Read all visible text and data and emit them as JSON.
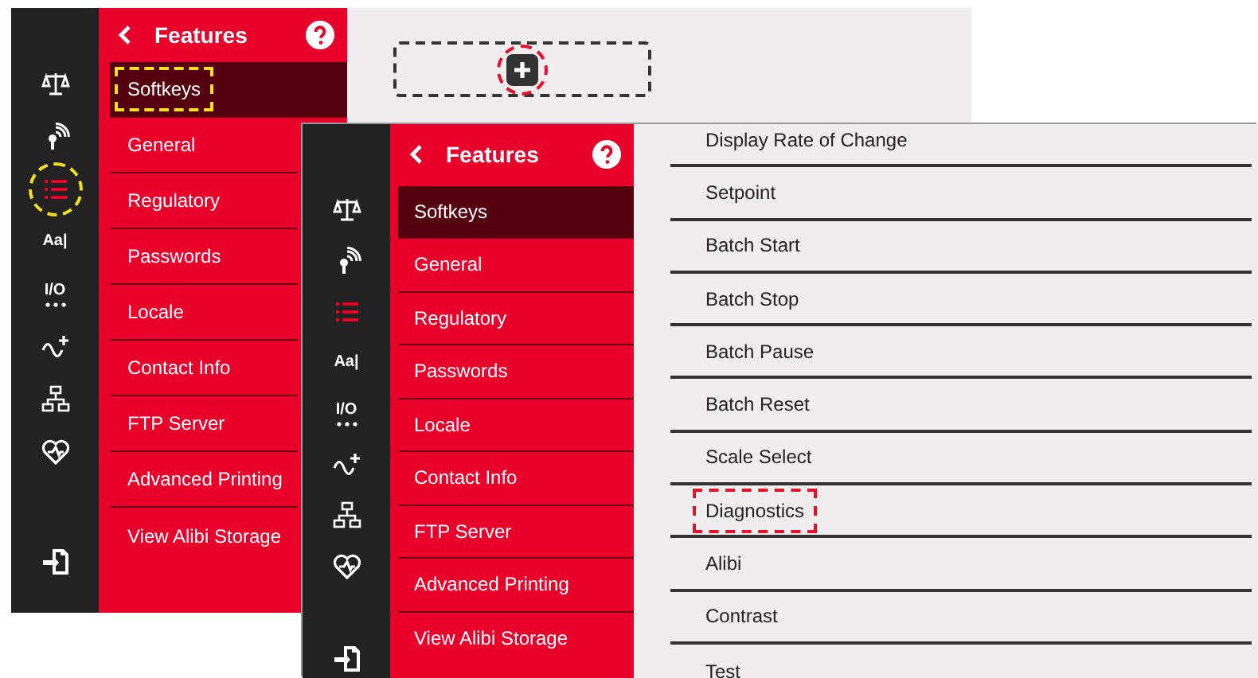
{
  "screens": [
    {
      "rail": [
        {
          "kind": "scale",
          "selected": false
        },
        {
          "kind": "signal",
          "selected": false
        },
        {
          "kind": "list",
          "selected": true,
          "highlighted": true,
          "color": "#f5e11a"
        },
        {
          "kind": "text",
          "label": "Aa|",
          "selected": false
        },
        {
          "kind": "io",
          "label": "I/O",
          "selected": false
        },
        {
          "kind": "wave",
          "selected": false
        },
        {
          "kind": "network",
          "selected": false
        },
        {
          "kind": "heart",
          "selected": false
        },
        {
          "kind": "exit",
          "selected": false
        }
      ],
      "panel": {
        "title": "Features",
        "items": [
          {
            "label": "Softkeys",
            "selected": true,
            "highlighted": true,
            "color": "#f5e11a"
          },
          {
            "label": "General",
            "selected": false
          },
          {
            "label": "Regulatory",
            "selected": false
          },
          {
            "label": "Passwords",
            "selected": false
          },
          {
            "label": "Locale",
            "selected": false
          },
          {
            "label": "Contact Info",
            "selected": false
          },
          {
            "label": "FTP Server",
            "selected": false
          },
          {
            "label": "Advanced Printing",
            "selected": false
          },
          {
            "label": "View Alibi Storage",
            "selected": false
          }
        ]
      },
      "content": {
        "kind": "add-slot",
        "highlighted": true,
        "color": "#e8102a"
      }
    },
    {
      "rail": [
        {
          "kind": "scale",
          "selected": false
        },
        {
          "kind": "signal",
          "selected": false
        },
        {
          "kind": "list",
          "selected": true
        },
        {
          "kind": "text",
          "label": "Aa|",
          "selected": false
        },
        {
          "kind": "io",
          "label": "I/O",
          "selected": false
        },
        {
          "kind": "wave",
          "selected": false
        },
        {
          "kind": "network",
          "selected": false
        },
        {
          "kind": "heart",
          "selected": false
        },
        {
          "kind": "exit",
          "selected": false
        }
      ],
      "panel": {
        "title": "Features",
        "items": [
          {
            "label": "Softkeys",
            "selected": true
          },
          {
            "label": "General",
            "selected": false
          },
          {
            "label": "Regulatory",
            "selected": false
          },
          {
            "label": "Passwords",
            "selected": false
          },
          {
            "label": "Locale",
            "selected": false
          },
          {
            "label": "Contact Info",
            "selected": false
          },
          {
            "label": "FTP Server",
            "selected": false
          },
          {
            "label": "Advanced Printing",
            "selected": false
          },
          {
            "label": "View Alibi Storage",
            "selected": false
          }
        ]
      },
      "content": {
        "kind": "list",
        "items": [
          {
            "label": "Display Rate of Change"
          },
          {
            "label": "Setpoint"
          },
          {
            "label": "Batch Start"
          },
          {
            "label": "Batch Stop"
          },
          {
            "label": "Batch Pause"
          },
          {
            "label": "Batch Reset"
          },
          {
            "label": "Scale Select"
          },
          {
            "label": "Diagnostics",
            "highlighted": true,
            "color": "#e8102a"
          },
          {
            "label": "Alibi"
          },
          {
            "label": "Contrast"
          },
          {
            "label": "Test"
          }
        ]
      }
    }
  ]
}
